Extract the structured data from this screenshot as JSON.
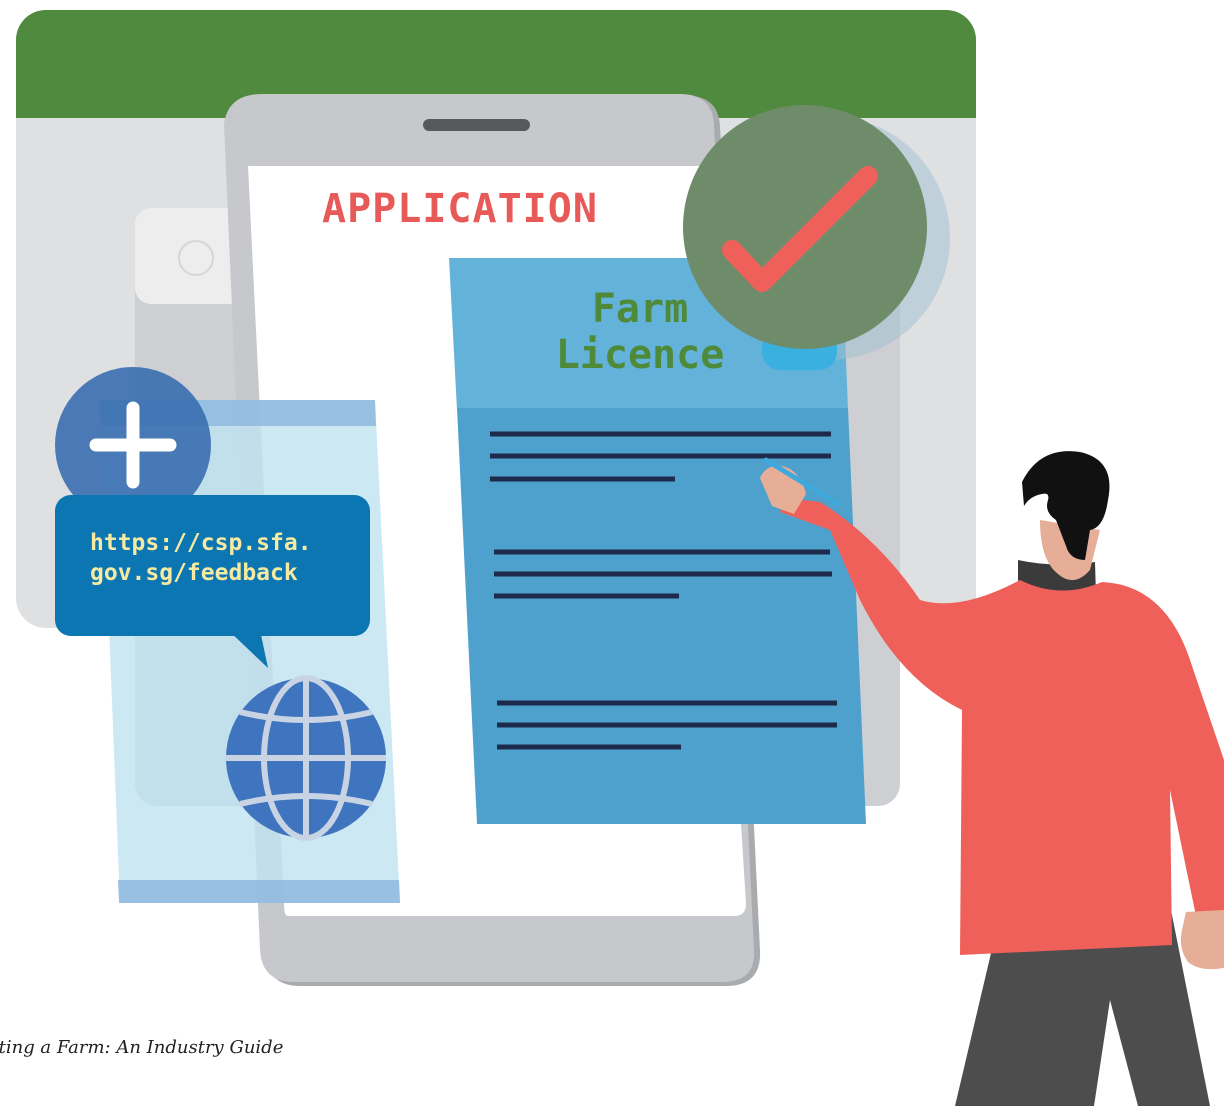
{
  "document": {
    "heading": "APPLICATION",
    "licence_title": "Farm\nLicence",
    "feedback_url": "https://csp.sfa.\ngov.sg/feedback",
    "caption": "rting a Farm: An Industry Guide"
  },
  "icons": {
    "add": "plus-icon",
    "approved": "checkmark-icon",
    "web": "globe-icon",
    "pen": "pen-icon"
  },
  "colors": {
    "header_green": "#4f8a3e",
    "accent_red": "#f0605a",
    "licence_blue": "#4fa1cd",
    "speech_blue": "#0b76b2",
    "check_green": "#6f8c6a"
  }
}
